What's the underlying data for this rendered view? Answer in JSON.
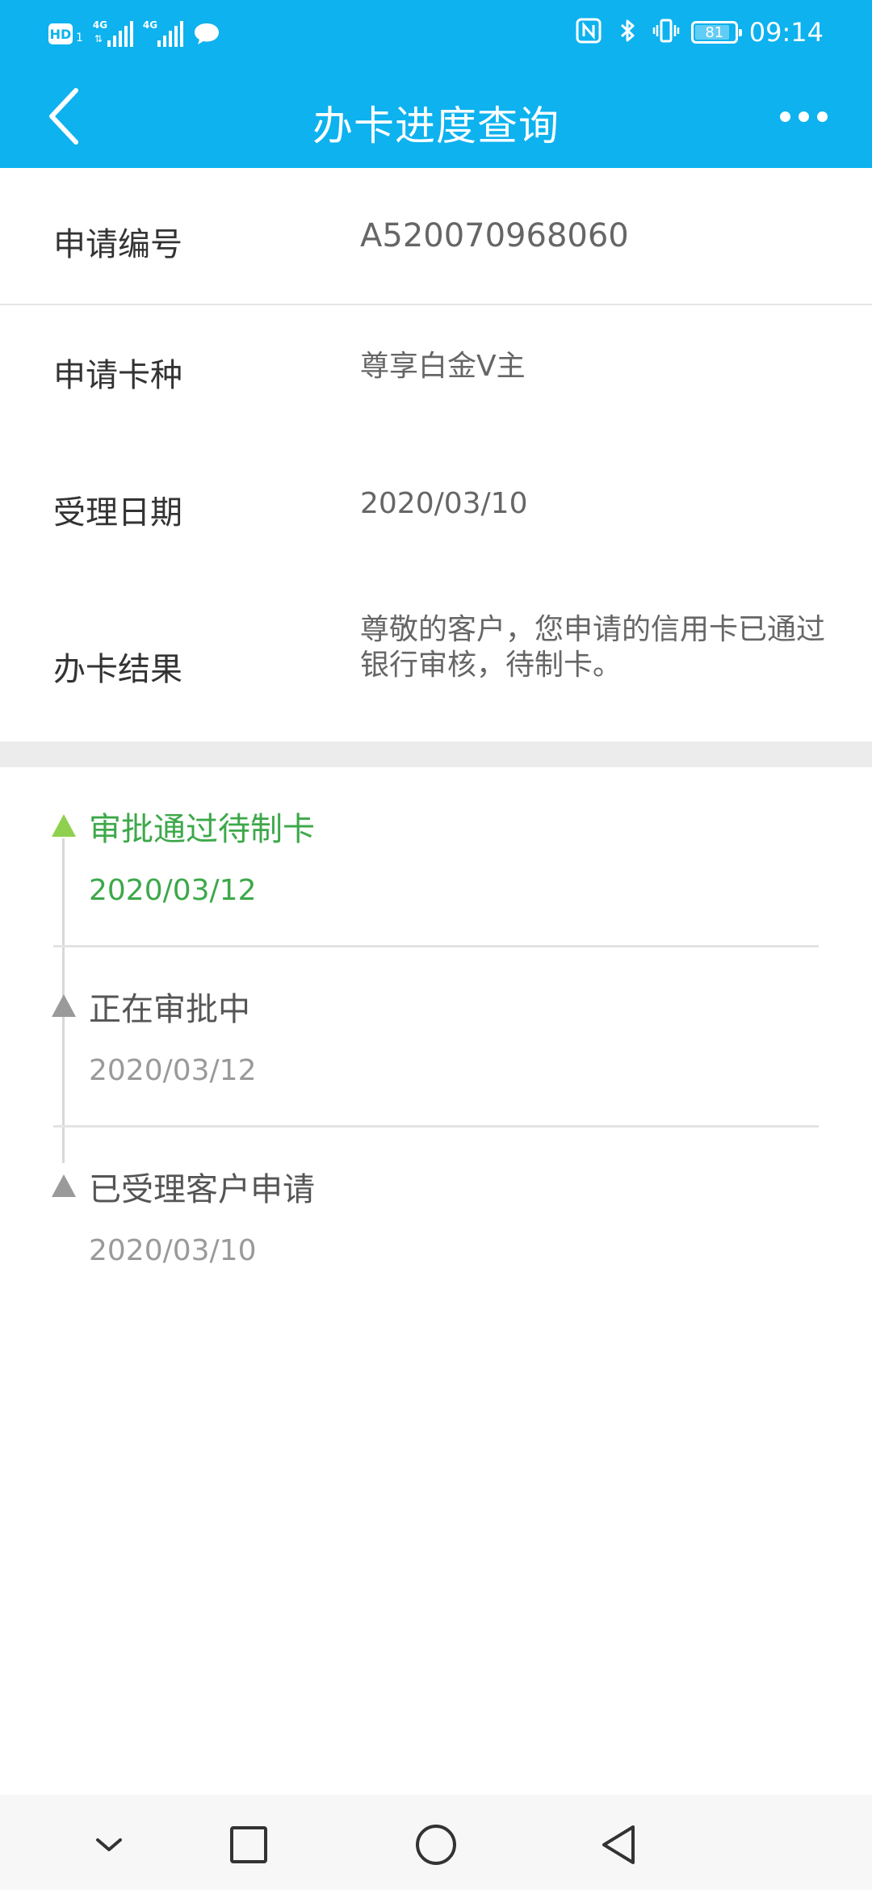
{
  "status_bar": {
    "left_icons": [
      "hd-icon",
      "signal-4g-icon",
      "signal-4g-icon",
      "message-icon"
    ],
    "hd_label": "HD",
    "hd_sub": "1",
    "network_label_1": "4G",
    "network_label_2": "4G",
    "right_icons": [
      "nfc-icon",
      "bluetooth-icon",
      "vibrate-icon",
      "battery-icon"
    ],
    "battery_level": "81",
    "time": "09:14"
  },
  "app_bar": {
    "title": "办卡进度查询",
    "back_icon": "chevron-left-icon",
    "more_icon": "more-dots-icon"
  },
  "info": {
    "application_number": {
      "label": "申请编号",
      "value": "A520070968060"
    },
    "card_type": {
      "label": "申请卡种",
      "value": "尊享白金V主"
    },
    "accept_date": {
      "label": "受理日期",
      "value": "2020/03/10"
    },
    "result": {
      "label": "办卡结果",
      "value": "尊敬的客户，您申请的信用卡已通过银行审核，待制卡。"
    }
  },
  "timeline": [
    {
      "title": "审批通过待制卡",
      "date": "2020/03/12",
      "active": true
    },
    {
      "title": "正在审批中",
      "date": "2020/03/12",
      "active": false
    },
    {
      "title": "已受理客户申请",
      "date": "2020/03/10",
      "active": false
    }
  ],
  "colors": {
    "header": "#0db2ef",
    "active_marker": "#8fd14f",
    "active_text": "#3da84a",
    "inactive_marker": "#9a9a9a",
    "section_gap": "#ececec"
  },
  "nav_bar": {
    "buttons": [
      "chevron-down-icon",
      "recent-apps-icon",
      "home-icon",
      "back-triangle-icon"
    ]
  }
}
